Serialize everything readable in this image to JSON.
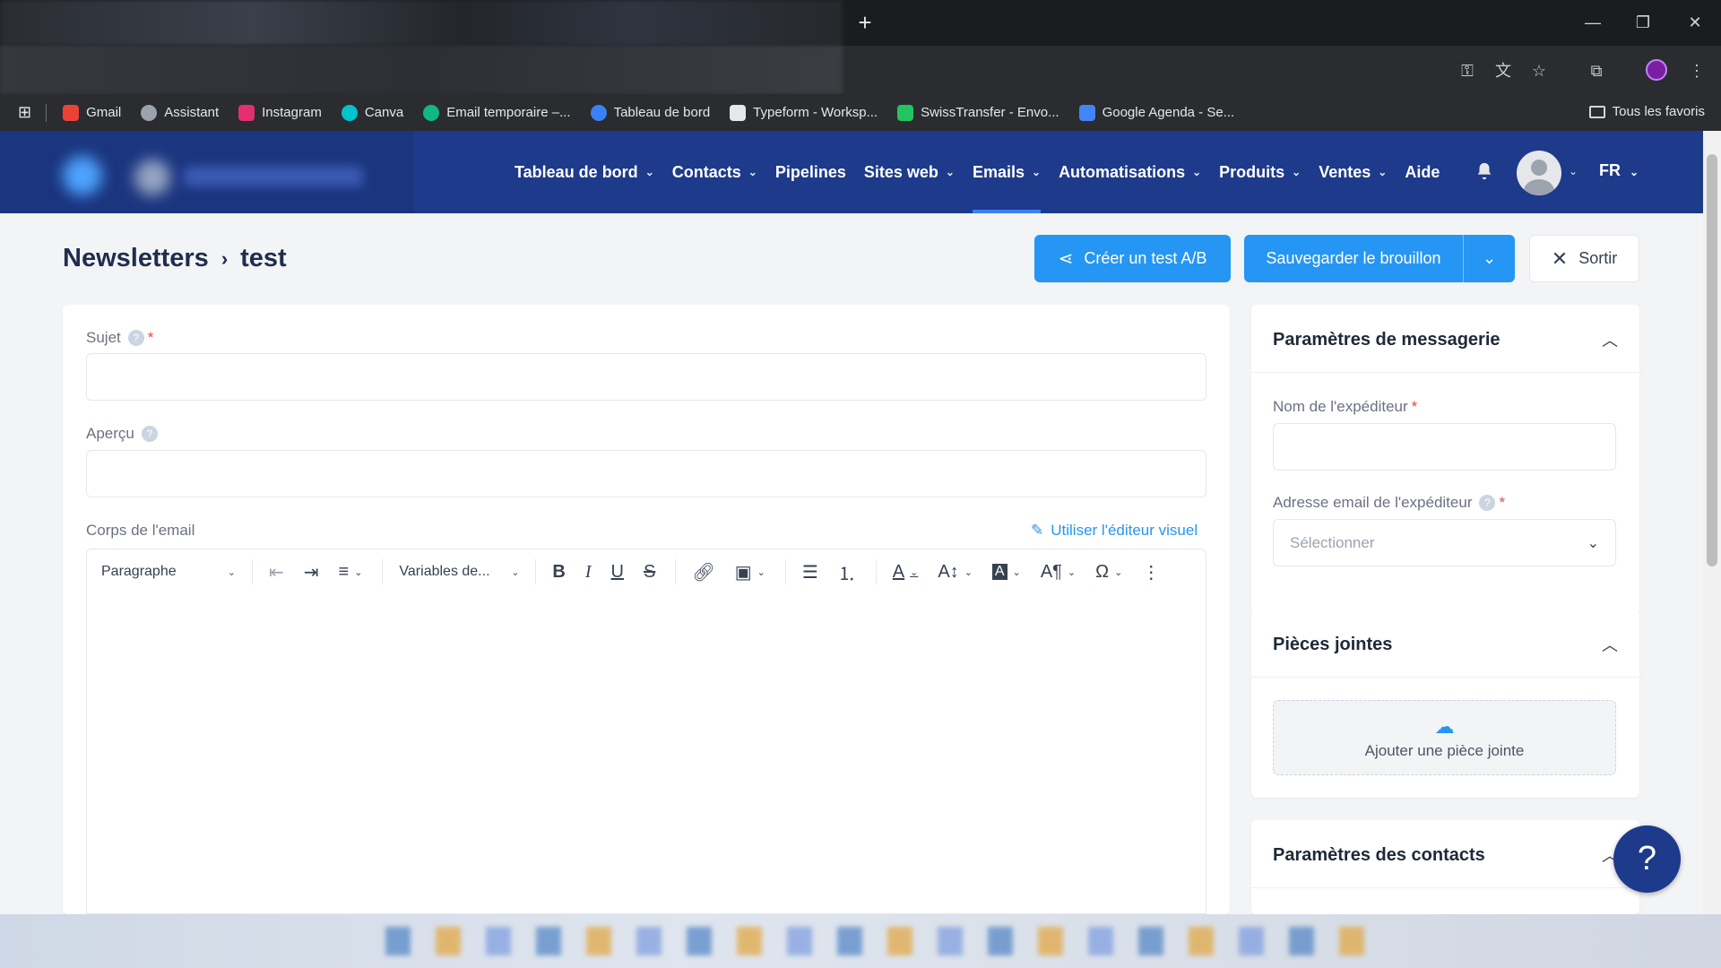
{
  "browser": {
    "new_tab_label": "+",
    "window_controls": [
      "—",
      "❐",
      "✕"
    ],
    "bookmarks": [
      {
        "label": "Gmail",
        "color": "#ea4335"
      },
      {
        "label": "Assistant",
        "color": "#9ca3af"
      },
      {
        "label": "Instagram",
        "color": "#e1306c"
      },
      {
        "label": "Canva",
        "color": "#00c4cc"
      },
      {
        "label": "Email temporaire –...",
        "color": "#10b981"
      },
      {
        "label": "Tableau de bord",
        "color": "#3b82f6"
      },
      {
        "label": "Typeform - Worksp...",
        "color": "#e5e7eb"
      },
      {
        "label": "SwissTransfer - Envo...",
        "color": "#22c55e"
      },
      {
        "label": "Google Agenda - Se...",
        "color": "#4285f4"
      }
    ],
    "all_bookmarks_label": "Tous les favoris"
  },
  "header": {
    "nav": [
      {
        "label": "Tableau de bord",
        "dropdown": true
      },
      {
        "label": "Contacts",
        "dropdown": true
      },
      {
        "label": "Pipelines",
        "dropdown": false
      },
      {
        "label": "Sites web",
        "dropdown": true
      },
      {
        "label": "Emails",
        "dropdown": true,
        "active": true
      },
      {
        "label": "Automatisations",
        "dropdown": true
      },
      {
        "label": "Produits",
        "dropdown": true
      },
      {
        "label": "Ventes",
        "dropdown": true
      },
      {
        "label": "Aide",
        "dropdown": false
      }
    ],
    "language": "FR",
    "accent_color": "#1e3a8a"
  },
  "page": {
    "breadcrumb_parent": "Newsletters",
    "breadcrumb_separator": "›",
    "breadcrumb_current": "test",
    "ab_test_label": "Créer un test A/B",
    "save_draft_label": "Sauvegarder le brouillon",
    "exit_label": "Sortir",
    "primary_color": "#2596f3"
  },
  "form": {
    "subject_label": "Sujet",
    "subject_value": "",
    "preview_label": "Aperçu",
    "preview_value": "",
    "body_label": "Corps de l'email",
    "visual_editor_link": "Utiliser l'éditeur visuel",
    "required_mark": "*",
    "help_mark": "?"
  },
  "toolbar": {
    "paragraph_label": "Paragraphe",
    "variables_label": "Variables de..."
  },
  "sidebar": {
    "messaging": {
      "title": "Paramètres de messagerie",
      "sender_name_label": "Nom de l'expéditeur",
      "sender_name_value": "",
      "sender_email_label": "Adresse email de l'expéditeur",
      "sender_email_placeholder": "Sélectionner"
    },
    "attachments": {
      "title": "Pièces jointes",
      "add_label": "Ajouter une pièce jointe"
    },
    "contacts": {
      "title": "Paramètres des contacts"
    }
  },
  "help_fab_label": "?"
}
